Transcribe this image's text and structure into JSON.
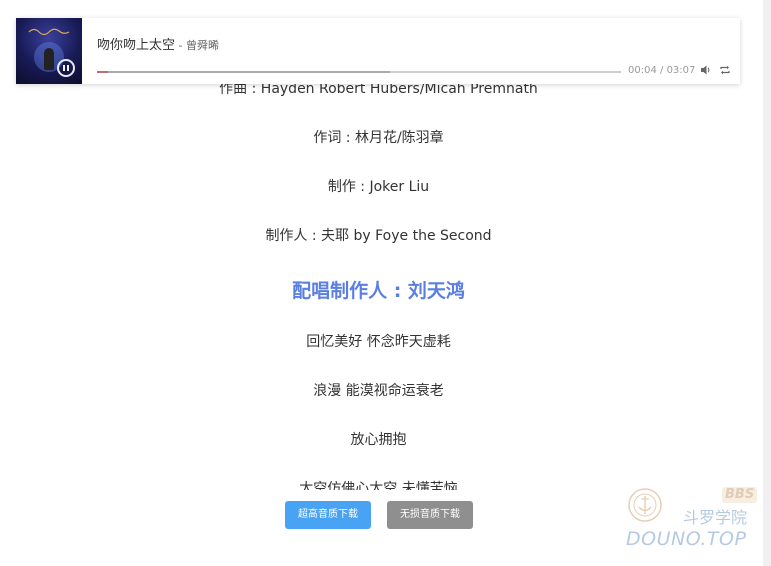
{
  "player": {
    "cover_icon": "album-cover",
    "pause_icon": "pause-icon",
    "title": "吻你吻上太空",
    "artist_separator": " - ",
    "artist": "曾舜晞",
    "current_time": "00:04",
    "time_separator": " / ",
    "duration": "03:07",
    "progress_fraction": 0.021,
    "loaded_fraction": 0.56,
    "volume_icon": "volume-icon",
    "loop_icon": "loop-icon",
    "colors": {
      "played": "#b7726f",
      "accent": "#5b7fe0"
    }
  },
  "lyrics": [
    {
      "text": "作曲 : Hayden Robert Hubers/Micah Premnath",
      "active": false
    },
    {
      "text": "作词 : 林月花/陈羽章",
      "active": false
    },
    {
      "text": "制作 : Joker Liu",
      "active": false
    },
    {
      "text": "制作人 : 夫耶 by Foye the Second",
      "active": false
    },
    {
      "text": "配唱制作人 : 刘天鸿",
      "active": true
    },
    {
      "text": "回忆美好 怀念昨天虚耗",
      "active": false
    },
    {
      "text": "浪漫 能漠视命运衰老",
      "active": false
    },
    {
      "text": "放心拥抱",
      "active": false
    },
    {
      "text": "太空仿佛心太空 未懂苦恼",
      "active": false
    }
  ],
  "downloads": {
    "hq_label": "超高音质下载",
    "lossless_label": "无损音质下载",
    "hq_color": "#49a3f5",
    "lossless_color": "#8f8f8f"
  },
  "watermark": {
    "badge": "BBS",
    "name_cn": "斗罗学院",
    "domain": "DOUNO.TOP",
    "emblem_icon": "emblem-icon"
  }
}
